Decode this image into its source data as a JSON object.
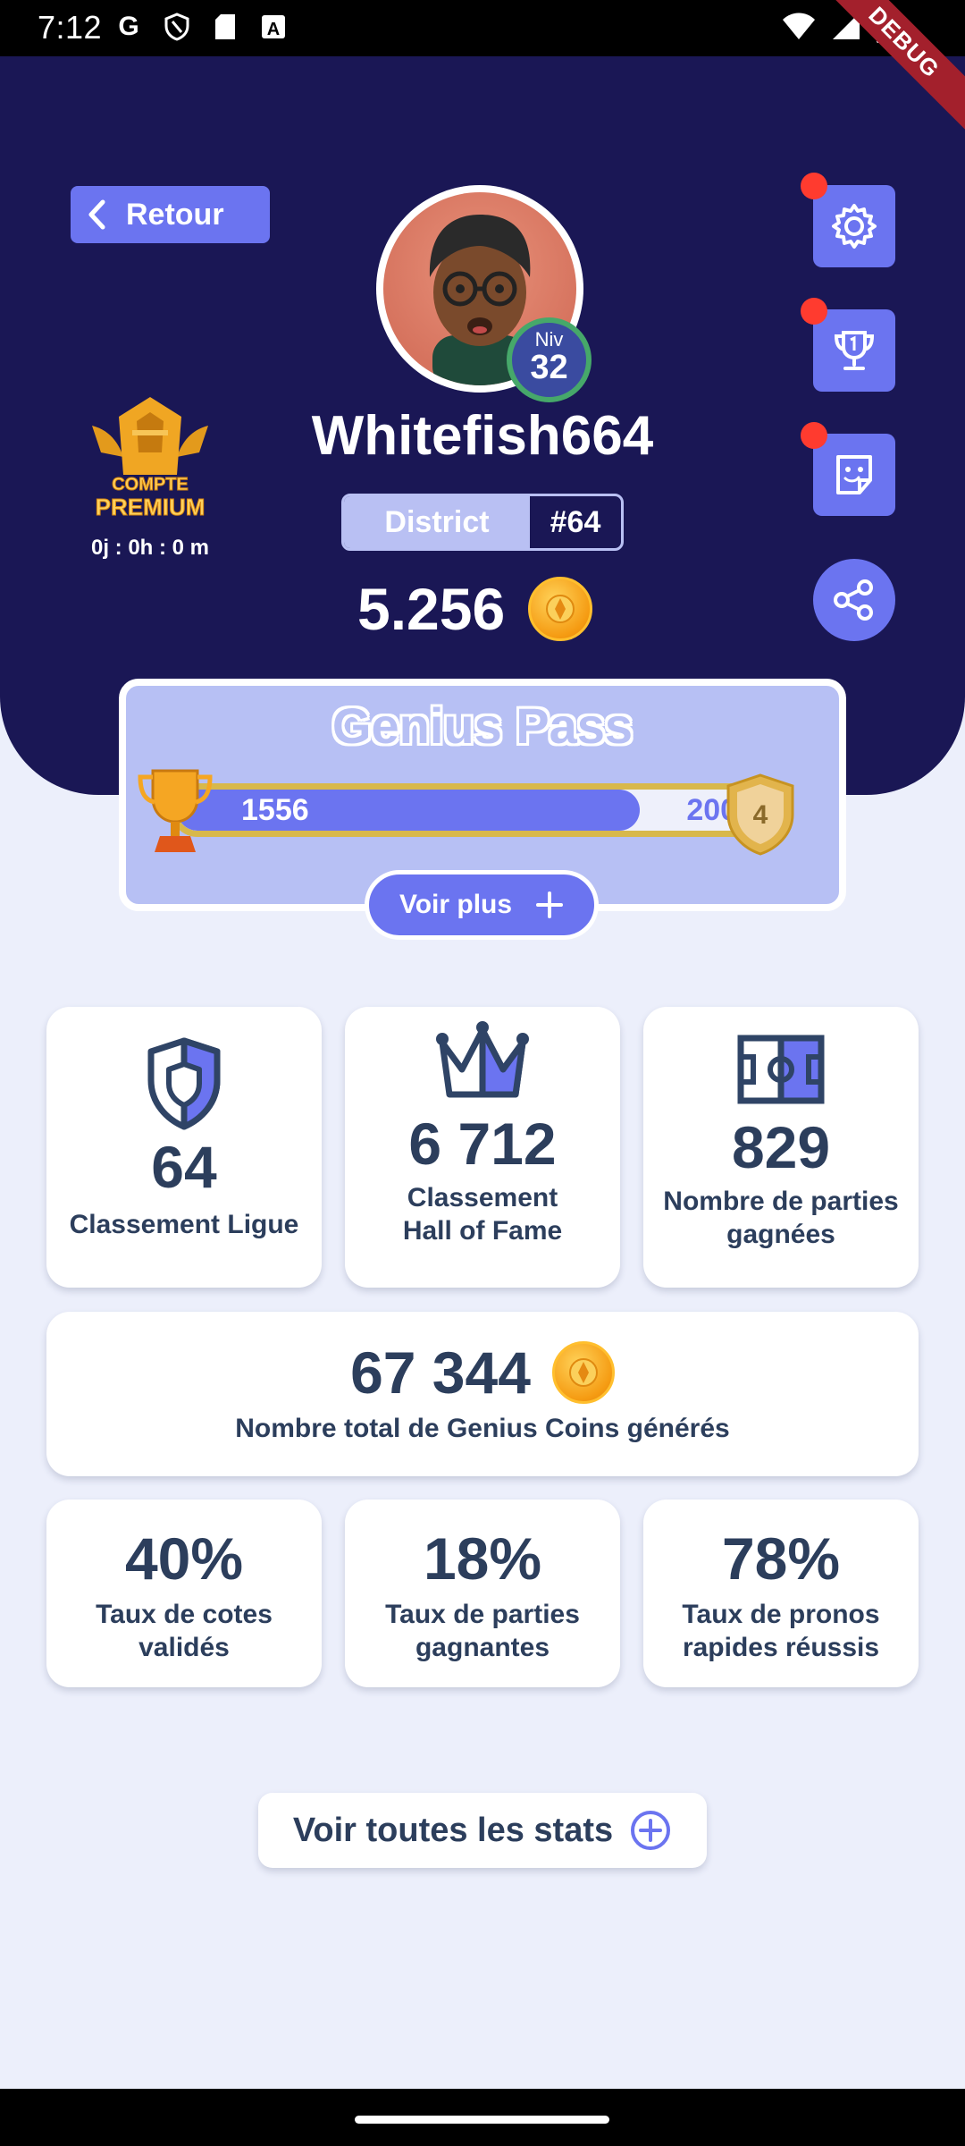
{
  "status_bar": {
    "time": "7:12",
    "icons": [
      "google-icon",
      "shield-icon",
      "sd-card-icon",
      "font-icon",
      "wifi-icon",
      "signal-icon",
      "battery-icon"
    ],
    "debug_label": "DEBUG"
  },
  "header": {
    "back_label": "Retour",
    "level_prefix": "Niv",
    "level": "32",
    "username": "Whitefish664",
    "district_label": "District",
    "district_number": "#64",
    "coins": "5.256",
    "premium_text_1": "COMPTE",
    "premium_text_2": "PREMIUM",
    "premium_timer": "0j : 0h : 0 m"
  },
  "genius_pass": {
    "title": "Genius Pass",
    "current": "1556",
    "target": "2000",
    "progress": 0.778,
    "tier": "4",
    "more_label": "Voir plus"
  },
  "stats": {
    "league_rank": {
      "value": "64",
      "label": "Classement Ligue"
    },
    "hall_of_fame": {
      "value": "6 712",
      "label_1": "Classement",
      "label_2": "Hall of Fame"
    },
    "games_won": {
      "value": "829",
      "label_1": "Nombre de parties",
      "label_2": "gagnées"
    },
    "total_coins": {
      "value": "67 344",
      "label": "Nombre total de Genius Coins générés"
    },
    "odds_rate": {
      "value": "40%",
      "label_1": "Taux de cotes",
      "label_2": "validés"
    },
    "win_rate": {
      "value": "18%",
      "label_1": "Taux de parties",
      "label_2": "gagnantes"
    },
    "quick_rate": {
      "value": "78%",
      "label_1": "Taux de pronos",
      "label_2": "rapides réussis"
    }
  },
  "all_stats_label": "Voir toutes les stats",
  "colors": {
    "header_bg": "#1a1755",
    "accent": "#6b74f0",
    "page_bg": "#eceffb",
    "text": "#2c3e5c",
    "notification": "#ff3b2f"
  }
}
